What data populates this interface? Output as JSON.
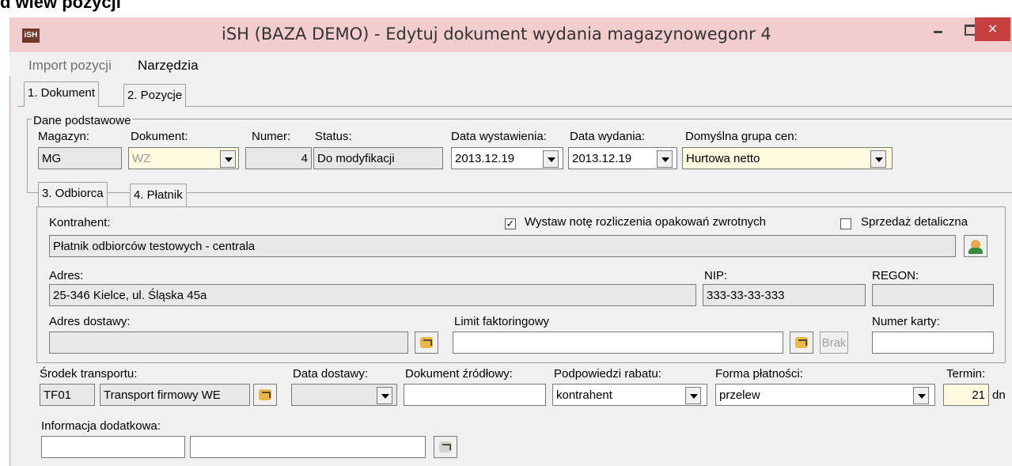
{
  "page_top": {
    "text": "d wiew pozycji"
  },
  "window": {
    "title": "iSH (BAZA DEMO) - Edytuj dokument wydania magazynowegonr 4",
    "icon_text": "iSH",
    "close_glyph": "×"
  },
  "menu": {
    "items": [
      "Import pozycji",
      "Narzędzia"
    ]
  },
  "tabs": [
    "1. Dokument",
    "2. Pozycje"
  ],
  "basic": {
    "group_title": "Dane podstawowe",
    "magazyn": {
      "label": "Magazyn:",
      "value": "MG"
    },
    "dokument": {
      "label": "Dokument:",
      "value": "WZ"
    },
    "numer": {
      "label": "Numer:",
      "value": "4"
    },
    "status": {
      "label": "Status:",
      "value": "Do modyfikacji"
    },
    "data_wystawienia": {
      "label": "Data wystawienia:",
      "value": "2013.12.19"
    },
    "data_wydania": {
      "label": "Data wydania:",
      "value": "2013.12.19"
    },
    "grupa_cen": {
      "label": "Domyślna grupa cen:",
      "value": "Hurtowa netto"
    }
  },
  "subtabs": [
    "3. Odbiorca",
    "4. Płatnik"
  ],
  "odbiorca": {
    "kontrahent_label": "Kontrahent:",
    "kontrahent_value": "Płatnik odbiorców testowych - centrala",
    "chk_nota_label": "Wystaw notę rozliczenia opakowań zwrotnych",
    "chk_nota_checked": true,
    "chk_nota_glyph": "✓",
    "chk_detal_label": "Sprzedaż detaliczna",
    "chk_detal_checked": false,
    "adres_label": "Adres:",
    "adres_value": "25-346 Kielce, ul. Śląska 45a",
    "nip_label": "NIP:",
    "nip_value": "333-33-33-333",
    "regon_label": "REGON:",
    "regon_value": "",
    "adres_dostawy_label": "Adres dostawy:",
    "adres_dostawy_value": "",
    "limit_label": "Limit faktoringowy",
    "limit_value": "",
    "brak_label": "Brak",
    "numer_karty_label": "Numer karty:",
    "numer_karty_value": ""
  },
  "transport": {
    "srodek_label": "Środek transportu:",
    "srodek_code": "TF01",
    "srodek_name": "Transport firmowy WE",
    "data_dostawy_label": "Data dostawy:",
    "data_dostawy_value": "",
    "dok_zrodlowy_label": "Dokument źródłowy:",
    "dok_zrodlowy_value": "",
    "rabat_label": "Podpowiedzi rabatu:",
    "rabat_value": "kontrahent",
    "forma_label": "Forma płatności:",
    "forma_value": "przelew",
    "termin_label": "Termin:",
    "termin_value": "21",
    "termin_unit": "dn",
    "info_label": "Informacja dodatkowa:",
    "info_value1": "",
    "info_value2": ""
  }
}
